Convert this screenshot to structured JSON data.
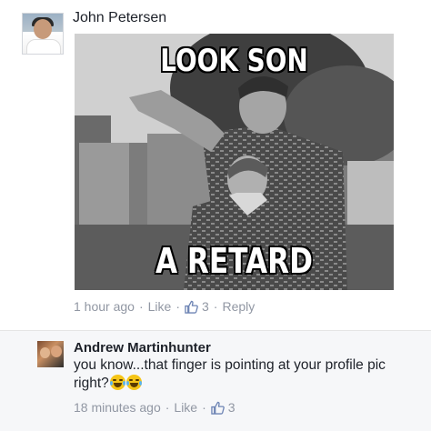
{
  "post": {
    "author": "John Petersen",
    "meme": {
      "top_caption": "LOOK SON",
      "bottom_caption": "A RETARD"
    },
    "time": "1 hour ago",
    "like_label": "Like",
    "like_count": "3",
    "reply_label": "Reply",
    "separator": "·"
  },
  "reply": {
    "author": "Andrew Martinhunter",
    "text": "you know...that finger is pointing at your profile pic right?",
    "emojis": [
      "tears-of-joy-icon",
      "tears-of-joy-icon"
    ],
    "time": "18 minutes ago",
    "like_label": "Like",
    "like_count": "3",
    "separator": "·"
  },
  "colors": {
    "meta_text": "#9197a3",
    "thumb": "#6d84b4",
    "reply_background": "#f6f7f9"
  }
}
